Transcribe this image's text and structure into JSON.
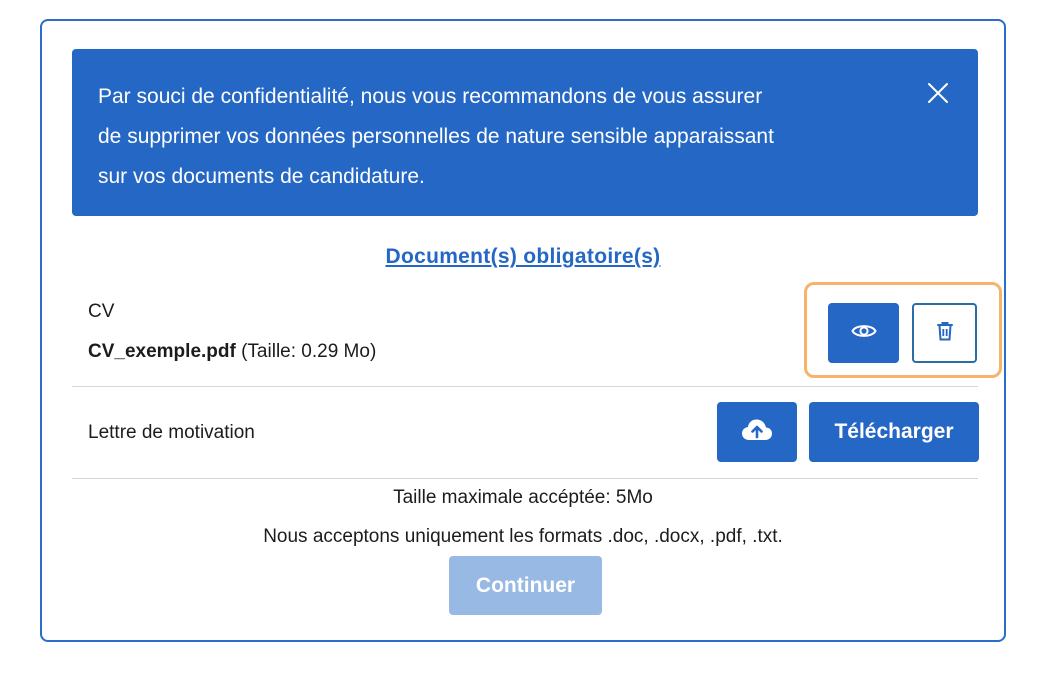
{
  "alert": {
    "message_line1": "Par souci de confidentialité, nous vous recommandons de vous assurer",
    "message_line2": "de supprimer vos données personnelles de nature sensible apparaissant",
    "message_line3": "sur vos documents de candidature.",
    "close_icon": "close-icon"
  },
  "section": {
    "title": "Document(s) obligatoire(s)"
  },
  "documents": [
    {
      "label": "CV",
      "file_name": "CV_exemple.pdf",
      "file_size": "(Taille: 0.29 Mo)",
      "actions": {
        "view_icon": "eye-icon",
        "delete_icon": "trash-icon"
      }
    },
    {
      "label": "Lettre de motivation",
      "actions": {
        "upload_icon": "cloud-upload-icon",
        "upload_label": "Télécharger"
      }
    }
  ],
  "footer": {
    "max_size": "Taille maximale accéptée: 5Mo",
    "formats": "Nous acceptons uniquement les formats .doc, .docx, .pdf, .txt.",
    "continue_label": "Continuer"
  },
  "colors": {
    "primary": "#2567c4",
    "primary_disabled": "#98b9e4",
    "highlight": "#f7b36b",
    "border": "#2a6ec7"
  }
}
